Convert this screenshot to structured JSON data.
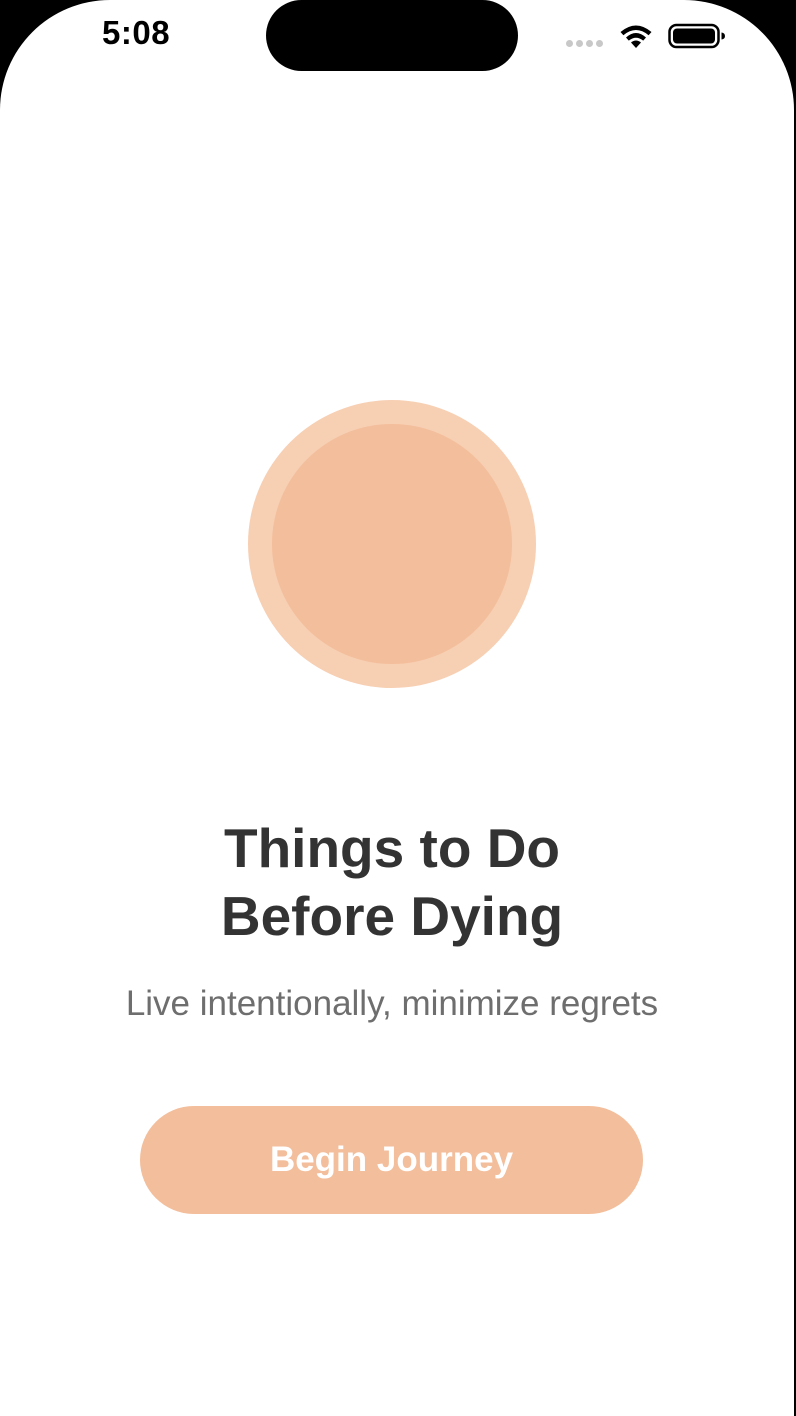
{
  "status_bar": {
    "time": "5:08",
    "icons": [
      "signal-dots-icon",
      "wifi-icon",
      "battery-icon"
    ]
  },
  "hero": {
    "icon": "sun-circle-icon",
    "outer_color": "#f7cfb3",
    "inner_color": "#f3be9b"
  },
  "title": {
    "line1": "Things to Do",
    "line2": "Before Dying"
  },
  "subtitle": "Live intentionally, minimize regrets",
  "cta": {
    "label": "Begin Journey",
    "color": "#f3be9b"
  },
  "colors": {
    "background": "#ffffff",
    "title": "#333333",
    "subtitle": "#6e6e6e"
  }
}
